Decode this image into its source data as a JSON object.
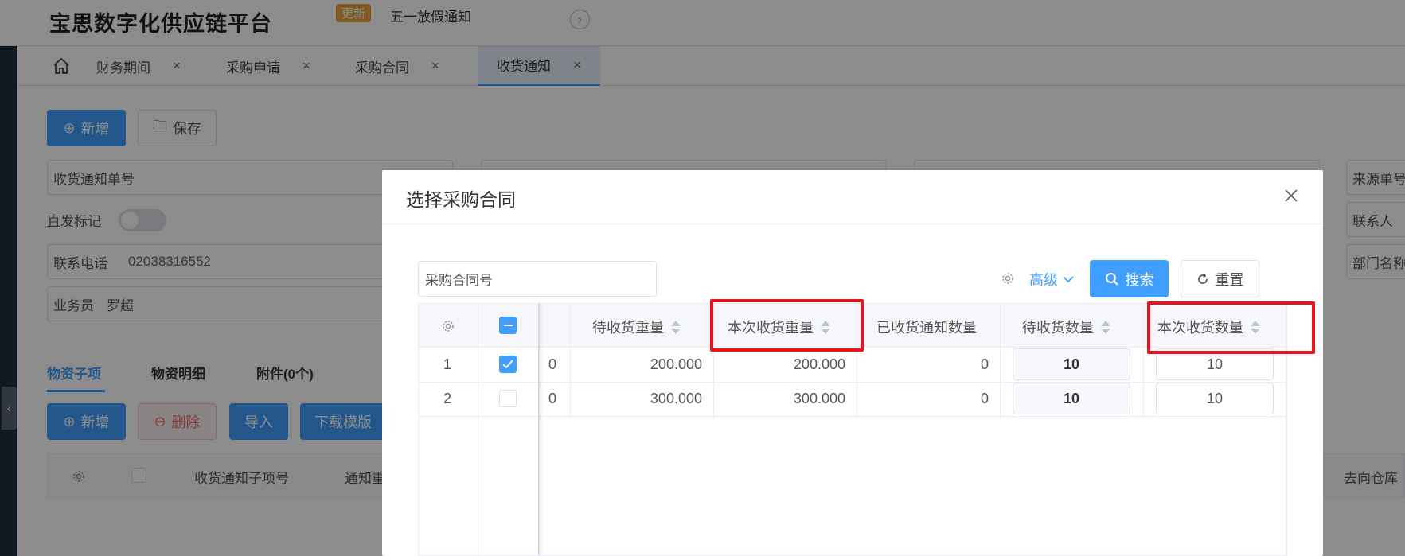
{
  "app": {
    "title": "宝思数字化供应链平台",
    "news_badge": "更新",
    "news_text": "五一放假通知"
  },
  "tabs": [
    {
      "label": "财务期间",
      "active": false
    },
    {
      "label": "采购申请",
      "active": false
    },
    {
      "label": "采购合同",
      "active": false
    },
    {
      "label": "收货通知",
      "active": true
    }
  ],
  "tab_close_glyph": "×",
  "form": {
    "add_label": "新增",
    "save_label": "保存",
    "notice_no_label": "收货通知单号",
    "direct_flag_label": "直发标记",
    "phone_label": "联系电话",
    "phone_value": "02038316552",
    "salesman_label": "业务员",
    "salesman_value": "罗超",
    "source_no_label": "来源单号",
    "contact_label": "联系人",
    "dept_label": "部门名称"
  },
  "sub_tabs": {
    "items": "物资子项",
    "details": "物资明细",
    "attachments": "附件(0个)"
  },
  "item_toolbar": {
    "add": "新增",
    "delete": "删除",
    "import": "导入",
    "download": "下载模版"
  },
  "bg_table": {
    "col_subitem": "收货通知子项号",
    "col_notice": "通知重",
    "col_warehouse": "去向仓库"
  },
  "modal": {
    "title": "选择采购合同",
    "search_placeholder": "采购合同号",
    "advanced": "高级",
    "search_button": "搜索",
    "reset_button": "重置",
    "columns": {
      "pending_weight": "待收货重量",
      "this_weight": "本次收货重量",
      "received_count": "已收货通知数量",
      "pending_qty": "待收货数量",
      "this_qty": "本次收货数量"
    },
    "rows": [
      {
        "index": "1",
        "checked": true,
        "hidden_val": "0",
        "pending_weight": "200.000",
        "this_weight": "200.000",
        "received_count": "0",
        "pending_qty": "10",
        "this_qty": "10"
      },
      {
        "index": "2",
        "checked": false,
        "hidden_val": "0",
        "pending_weight": "300.000",
        "this_weight": "300.000",
        "received_count": "0",
        "pending_qty": "10",
        "this_qty": "10"
      }
    ]
  },
  "colors": {
    "primary": "#409eff",
    "highlight": "#e8141b",
    "badge": "#e6a23c"
  }
}
